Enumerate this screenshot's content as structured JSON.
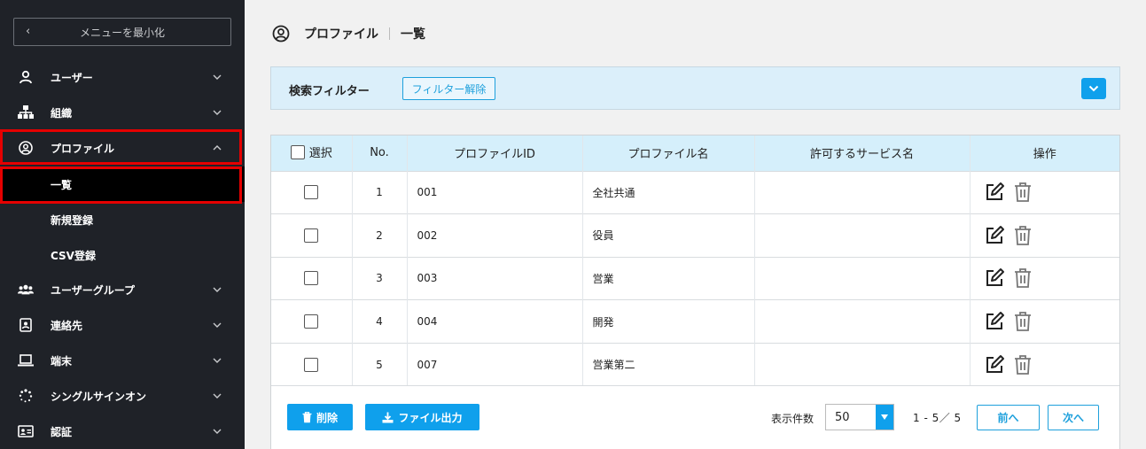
{
  "sidebar": {
    "collapse_label": "メニューを最小化",
    "items": [
      {
        "label": "ユーザー"
      },
      {
        "label": "組織"
      },
      {
        "label": "プロファイル"
      },
      {
        "label": "ユーザーグループ"
      },
      {
        "label": "連絡先"
      },
      {
        "label": "端末"
      },
      {
        "label": "シングルサインオン"
      },
      {
        "label": "認証"
      }
    ],
    "sub_items": [
      {
        "label": "一覧"
      },
      {
        "label": "新規登録"
      },
      {
        "label": "CSV登録"
      }
    ]
  },
  "header": {
    "title": "プロファイル",
    "subtitle": "一覧"
  },
  "filter": {
    "title": "検索フィルター",
    "clear_label": "フィルター解除"
  },
  "table": {
    "columns": {
      "select": "選択",
      "no": "No.",
      "id": "プロファイルID",
      "name": "プロファイル名",
      "service": "許可するサービス名",
      "ops": "操作"
    },
    "rows": [
      {
        "no": "1",
        "id": "001",
        "name": "全社共通",
        "service": ""
      },
      {
        "no": "2",
        "id": "002",
        "name": "役員",
        "service": ""
      },
      {
        "no": "3",
        "id": "003",
        "name": "営業",
        "service": ""
      },
      {
        "no": "4",
        "id": "004",
        "name": "開発",
        "service": ""
      },
      {
        "no": "5",
        "id": "007",
        "name": "営業第二",
        "service": ""
      }
    ]
  },
  "footer": {
    "delete_label": "削除",
    "export_label": "ファイル出力",
    "per_page_label": "表示件数",
    "per_page_value": "50",
    "range_text": "1 - 5／ 5",
    "prev_label": "前へ",
    "next_label": "次へ"
  },
  "colors": {
    "sidebar_bg": "#1f2228",
    "accent": "#0fa0ec",
    "header_row_bg": "#d5effb",
    "highlight": "#e50000"
  }
}
